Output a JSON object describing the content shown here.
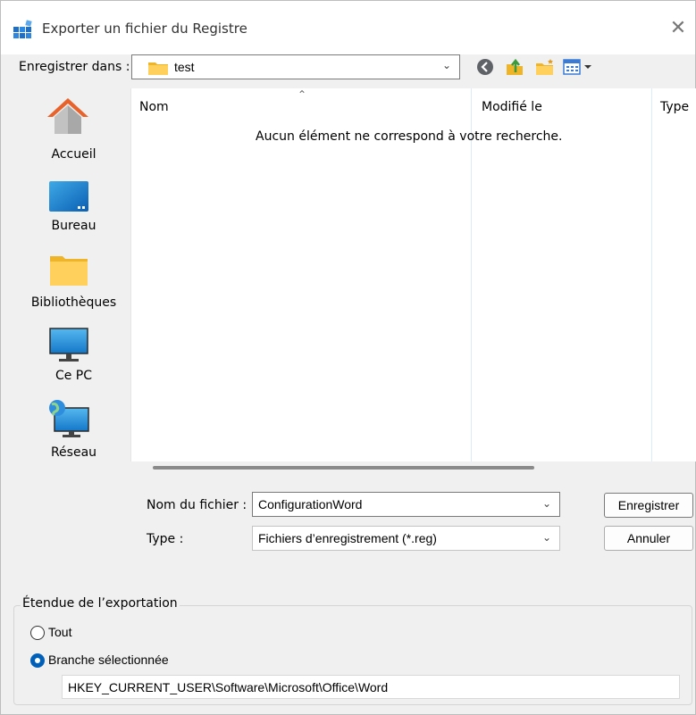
{
  "window": {
    "title": "Exporter un fichier du Registre",
    "close_glyph": "✕"
  },
  "save_in": {
    "label": "Enregistrer dans :",
    "value": "test"
  },
  "places": [
    {
      "label": "Accueil",
      "icon": "home-icon"
    },
    {
      "label": "Bureau",
      "icon": "desktop-icon"
    },
    {
      "label": "Bibliothèques",
      "icon": "libraries-icon"
    },
    {
      "label": "Ce PC",
      "icon": "computer-icon"
    },
    {
      "label": "Réseau",
      "icon": "network-icon"
    }
  ],
  "file_list": {
    "columns": [
      "Nom",
      "Modifié le",
      "Type"
    ],
    "empty_message": "Aucun élément ne correspond à votre recherche."
  },
  "filename": {
    "label": "Nom du fichier :",
    "value": "ConfigurationWord"
  },
  "filetype": {
    "label": "Type :",
    "value": "Fichiers d’enregistrement (*.reg)"
  },
  "buttons": {
    "save": "Enregistrer",
    "cancel": "Annuler"
  },
  "export_range": {
    "title": "Étendue de l’exportation",
    "option_all": "Tout",
    "option_branch": "Branche sélectionnée",
    "selected": "branch",
    "branch_path": "HKEY_CURRENT_USER\\Software\\Microsoft\\Office\\Word"
  },
  "colors": {
    "accent": "#005fb8",
    "folder": "#f7c948"
  }
}
